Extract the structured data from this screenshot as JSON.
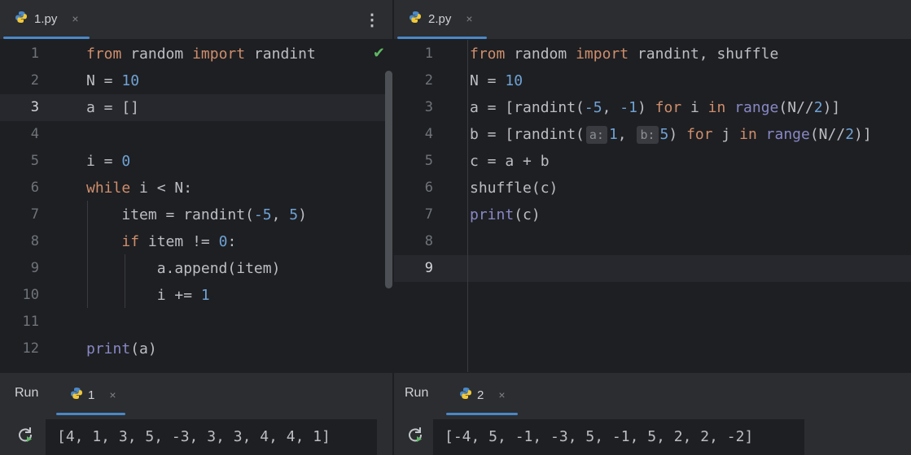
{
  "left": {
    "tab": {
      "label": "1.py",
      "close": "×"
    },
    "more": "⋮",
    "run": {
      "label": "Run",
      "tab_label": "1",
      "close": "×"
    },
    "output": "[4, 1, 3, 5, -3, 3, 3, 4, 4, 1]",
    "current_line": 3,
    "lines": [
      {
        "num": "1",
        "html": "<span class=\"k\">from</span> random <span class=\"k\">import</span> randint"
      },
      {
        "num": "2",
        "html": "N = <span class=\"n\">10</span>"
      },
      {
        "num": "3",
        "html": "a = []"
      },
      {
        "num": "4",
        "html": ""
      },
      {
        "num": "5",
        "html": "i = <span class=\"n\">0</span>"
      },
      {
        "num": "6",
        "html": "<span class=\"k\">while</span> i &lt; N:"
      },
      {
        "num": "7",
        "html": "    item = randint(<span class=\"n\">-5</span>, <span class=\"n\">5</span>)"
      },
      {
        "num": "8",
        "html": "    <span class=\"k\">if</span> item != <span class=\"n\">0</span>:"
      },
      {
        "num": "9",
        "html": "        a.append(item)"
      },
      {
        "num": "10",
        "html": "        i += <span class=\"n\">1</span>"
      },
      {
        "num": "11",
        "html": ""
      },
      {
        "num": "12",
        "html": "<span class=\"b\">print</span>(a)"
      }
    ]
  },
  "right": {
    "tab": {
      "label": "2.py",
      "close": "×"
    },
    "run": {
      "label": "Run",
      "tab_label": "2",
      "close": "×"
    },
    "output": "[-4, 5, -1, -3, 5, -1, 5, 2, 2, -2]",
    "current_line": 9,
    "lines": [
      {
        "num": "1",
        "html": "<span class=\"k\">from</span> random <span class=\"k\">import</span> randint, shuffle"
      },
      {
        "num": "2",
        "html": "N = <span class=\"n\">10</span>"
      },
      {
        "num": "3",
        "html": "a = [randint(<span class=\"n\">-5</span>, <span class=\"n\">-1</span>) <span class=\"k\">for</span> i <span class=\"k\">in</span> <span class=\"b\">range</span>(N//<span class=\"n\">2</span>)]"
      },
      {
        "num": "4",
        "html": "b = [randint(<span class=\"hint\">a:</span><span class=\"n\">1</span>, <span class=\"hint\">b:</span><span class=\"n\">5</span>) <span class=\"k\">for</span> j <span class=\"k\">in</span> <span class=\"b\">range</span>(N//<span class=\"n\">2</span>)]"
      },
      {
        "num": "5",
        "html": "c = a + b"
      },
      {
        "num": "6",
        "html": "shuffle(c)"
      },
      {
        "num": "7",
        "html": "<span class=\"b\">print</span>(c)"
      },
      {
        "num": "8",
        "html": ""
      },
      {
        "num": "9",
        "html": ""
      }
    ]
  }
}
